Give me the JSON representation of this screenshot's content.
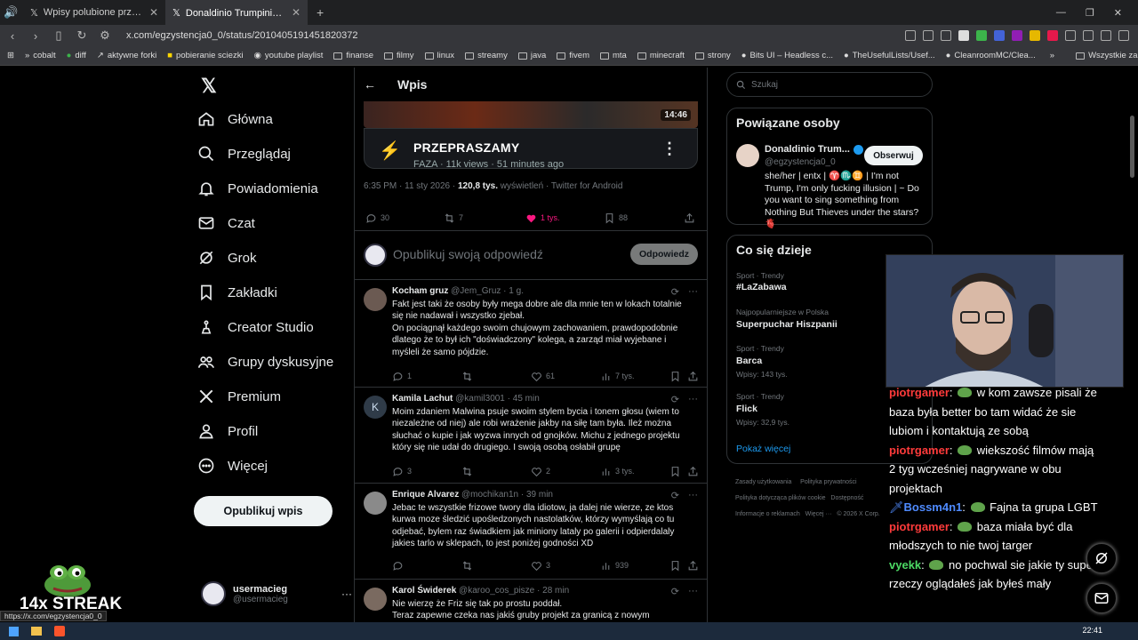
{
  "browser": {
    "tabs": [
      {
        "title": "Wpisy polubione przez usermacieg (@",
        "active": false
      },
      {
        "title": "Donaldinio Trumpinio 🟊 w serw",
        "active": true
      }
    ],
    "new_tab": "+",
    "url": "x.com/egzystencja0_0/status/2010405191451820372",
    "bookmarks": [
      "cobalt",
      "diff",
      "aktywne forki",
      "pobieranie sciezki",
      "youtube playlist",
      "finanse",
      "filmy",
      "linux",
      "streamy",
      "java",
      "fivem",
      "mta",
      "minecraft",
      "strony",
      "Bits UI – Headless c...",
      "TheUsefulLists/Usef...",
      "CleanroomMC/Clea..."
    ],
    "bookmarks_more": "»",
    "all_bookmarks": "Wszystkie zakładki"
  },
  "nav": {
    "items": [
      {
        "label": "Główna",
        "icon": "home-icon"
      },
      {
        "label": "Przeglądaj",
        "icon": "search-icon"
      },
      {
        "label": "Powiadomienia",
        "icon": "bell-icon"
      },
      {
        "label": "Czat",
        "icon": "mail-icon"
      },
      {
        "label": "Grok",
        "icon": "grok-icon"
      },
      {
        "label": "Zakładki",
        "icon": "bookmark-icon"
      },
      {
        "label": "Creator Studio",
        "icon": "creator-icon"
      },
      {
        "label": "Grupy dyskusyjne",
        "icon": "communities-icon"
      },
      {
        "label": "Premium",
        "icon": "x-logo-icon"
      },
      {
        "label": "Profil",
        "icon": "profile-icon"
      },
      {
        "label": "Więcej",
        "icon": "more-icon"
      }
    ],
    "post_button": "Opublikuj wpis",
    "user": {
      "name": "usermacieg",
      "handle": "@usermacieg",
      "more": "···"
    }
  },
  "header": {
    "back": "←",
    "title": "Wpis"
  },
  "video": {
    "duration": "14:46",
    "title": "PRZEPRASZAMY",
    "subtitle": "FAZA · 11k views · 51 minutes ago",
    "menu": "⋮"
  },
  "post": {
    "time": "6:35 PM · 11 sty 2026 · ",
    "views": "120,8 tys.",
    "views_label": " wyświetleń · Twitter for Android",
    "replies": "30",
    "reposts": "7",
    "likes": "1 tys.",
    "bookmarks": "88",
    "like_color": "#f91880"
  },
  "reply_box": {
    "placeholder": "Opublikuj swoją odpowiedź",
    "button": "Odpowiedz"
  },
  "replies": [
    {
      "name": "Kocham gruz",
      "meta": "@Jem_Gruz · 1 g.",
      "text": "Fakt jest taki że osoby były mega dobre ale dla mnie ten w lokach totalnie się nie nadawał i wszystko zjebał.\nOn pociągnął każdego swoim chujowym zachowaniem, prawdopodobnie dlatego że to był ich \"doświadczony\" kolega, a zarząd miał wyjebane i myśleli że samo pójdzie.",
      "replies": "1",
      "reposts": "",
      "likes": "61",
      "views": "7 tys."
    },
    {
      "name": "Kamila Lachut",
      "meta": "@kamil3001 · 45 min",
      "text": "Moim zdaniem Malwina psuje swoim stylem bycia i tonem głosu (wiem to niezależne od niej) ale robi wrażenie jakby na siłę tam była. Ileż można słuchać o kupie i jak wyzwa innych od gnojków. Michu z jednego projektu który się nie udał do drugiego. I swoją osobą osłabił grupę",
      "replies": "3",
      "reposts": "",
      "likes": "2",
      "views": "3 tys.",
      "initial": "K"
    },
    {
      "name": "Enrique Alvarez",
      "meta": "@mochikan1n · 39 min",
      "text": "Jebac te wszystkie frizowe twory dla idiotow, ja dalej nie wierze, ze ktos kurwa moze śledzić upośledzonych nastolatków, którzy wymyślają co tu odjebać, bylem raz świadkiem jak miniony lataly po galerii i odpierdalaly jakies tarlo w sklepach, to jest poniżej godności XD",
      "replies": "",
      "reposts": "",
      "likes": "3",
      "views": "939"
    },
    {
      "name": "Karol Świderek",
      "meta": "@karoo_cos_pisze · 28 min",
      "text": "Nie wierzę że Friz się tak po prostu poddał.\nTeraz zapewne czeka nas jakiś gruby projekt  za granicą z nowym",
      "replies": "",
      "reposts": "",
      "likes": "",
      "views": ""
    }
  ],
  "right": {
    "search_placeholder": "Szukaj",
    "related_title": "Powiązane osoby",
    "related_name": "Donaldinio Trum...",
    "related_handle": "@egzystencja0_0",
    "follow": "Obserwuj",
    "bio": "she/her | entx | ♈♏♊ | I'm not Trump, I'm only fucking illusion | ~ Do you want to sing something from Nothing But Thieves under the stars? 🫀",
    "trends_title": "Co się dzieje",
    "trends": [
      {
        "cat": "Sport · Trendy",
        "name": "#LaZabawa",
        "count": ""
      },
      {
        "cat": "Najpopularniejsze w Polska",
        "name": "Superpuchar Hiszpanii",
        "count": ""
      },
      {
        "cat": "Sport · Trendy",
        "name": "Barca",
        "count": "Wpisy: 143 tys."
      },
      {
        "cat": "Sport · Trendy",
        "name": "Flick",
        "count": "Wpisy: 32,9 tys."
      }
    ],
    "show_more": "Pokaż więcej",
    "footer": [
      "Zasady użytkowania",
      "Polityka prywatności",
      "Polityka dotycząca plików cookie",
      "Dostępność",
      "Informacje o reklamach",
      "Więcej ···",
      "© 2026 X Corp."
    ]
  },
  "chat": [
    {
      "user": "piotrgamer",
      "color": "#ff3b3b",
      "text": " w kom zawsze pisali że baza była better bo tam widać że sie lubiom i kontaktują ze sobą"
    },
    {
      "user": "piotrgamer",
      "color": "#ff3b3b",
      "text": " wiekszość filmów mają 2 tyg wcześniej nagrywane w obu projektach"
    },
    {
      "user": "Bossm4n1",
      "color": "#4f8bff",
      "text": " Fajna ta grupa LGBT"
    },
    {
      "user": "piotrgamer",
      "color": "#ff3b3b",
      "text": " baza miała być dla młodszych to nie twoj targer"
    },
    {
      "user": "vyekk",
      "color": "#4cd964",
      "text": " no pochwal sie jakie ty super rzeczy oglądałeś jak byłeś mały"
    }
  ],
  "streak": "14x STREAK",
  "status_url": "https://x.com/egzystencja0_0",
  "clock": "22:41"
}
